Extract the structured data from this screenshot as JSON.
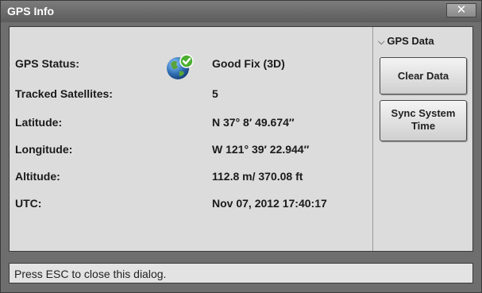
{
  "window": {
    "title": "GPS Info",
    "close_label": "✕"
  },
  "info": {
    "rows": [
      {
        "label": "GPS Status:",
        "value": "Good Fix (3D)"
      },
      {
        "label": "Tracked Satellites:",
        "value": "5"
      },
      {
        "label": "Latitude:",
        "value": "N 37° 8′ 49.674″"
      },
      {
        "label": "Longitude:",
        "value": "W 121° 39′ 22.944″"
      },
      {
        "label": "Altitude:",
        "value": "112.8 m/ 370.08 ft"
      },
      {
        "label": "UTC:",
        "value": "Nov 07, 2012 17:40:17"
      }
    ],
    "status_icon": "globe-check-icon"
  },
  "side": {
    "gps_data_label": "GPS Data",
    "clear_data_label": "Clear Data",
    "sync_line1": "Sync System",
    "sync_line2": "Time"
  },
  "status_bar": {
    "text": "Press ESC to close this dialog."
  },
  "colors": {
    "titlebar": "#6a6a6a",
    "content_bg": "#dcdcdc",
    "globe_blue": "#2f6fb3",
    "check_green": "#4caf2f"
  }
}
